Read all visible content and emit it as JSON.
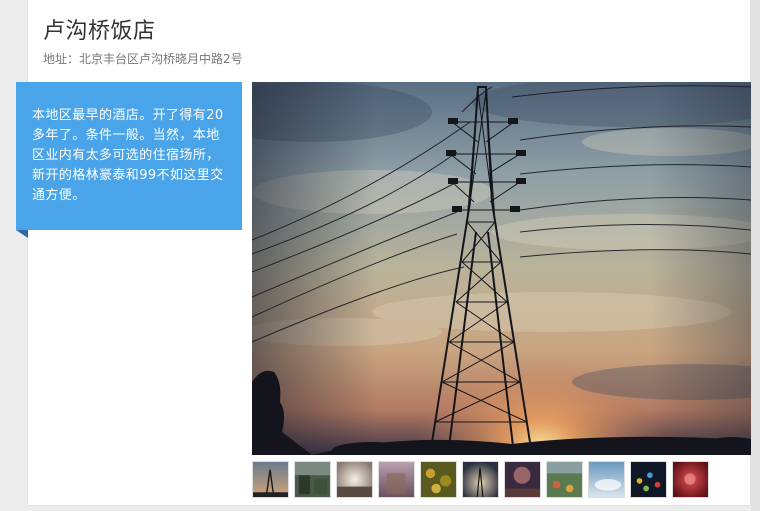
{
  "hotel": {
    "name": "卢沟桥饭店",
    "address": "地址：北京丰台区卢沟桥晓月中路2号"
  },
  "review": {
    "text": "本地区最早的酒店。开了得有20多年了。条件一般。当然，本地区业内有太多可选的住宿场所，新开的格林豪泰和99不如这里交通方便。"
  },
  "gallery": {
    "main_photo": "power-tower-sunset-photo",
    "thumbnails": [
      {
        "name": "thumb-1"
      },
      {
        "name": "thumb-2"
      },
      {
        "name": "thumb-3"
      },
      {
        "name": "thumb-4"
      },
      {
        "name": "thumb-5"
      },
      {
        "name": "thumb-6"
      },
      {
        "name": "thumb-7"
      },
      {
        "name": "thumb-8"
      },
      {
        "name": "thumb-9"
      },
      {
        "name": "thumb-10"
      },
      {
        "name": "thumb-11"
      }
    ]
  },
  "colors": {
    "accent": "#4aa4ea",
    "background": "#ececec",
    "card": "#ffffff"
  }
}
